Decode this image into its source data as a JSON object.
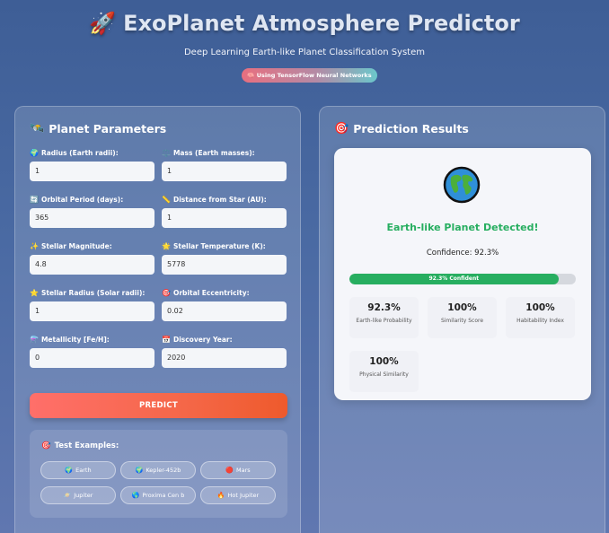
{
  "header": {
    "title": "ExoPlanet Atmosphere Predictor",
    "subtitle": "Deep Learning Earth-like Planet Classification System",
    "badge": "🧠 Using TensorFlow Neural Networks"
  },
  "left_panel": {
    "title": "Planet Parameters",
    "fields": [
      {
        "icon": "🌍",
        "label": "Radius (Earth radii):",
        "value": "1"
      },
      {
        "icon": "⚖️",
        "label": "Mass (Earth masses):",
        "value": "1"
      },
      {
        "icon": "🔄",
        "label": "Orbital Period (days):",
        "value": "365"
      },
      {
        "icon": "📏",
        "label": "Distance from Star (AU):",
        "value": "1"
      },
      {
        "icon": "✨",
        "label": "Stellar Magnitude:",
        "value": "4.8"
      },
      {
        "icon": "🌟",
        "label": "Stellar Temperature (K):",
        "value": "5778"
      },
      {
        "icon": "⭐",
        "label": "Stellar Radius (Solar radii):",
        "value": "1"
      },
      {
        "icon": "🎯",
        "label": "Orbital Eccentricity:",
        "value": "0.02"
      },
      {
        "icon": "⚗️",
        "label": "Metallicity [Fe/H]:",
        "value": "0"
      },
      {
        "icon": "📅",
        "label": "Discovery Year:",
        "value": "2020"
      }
    ],
    "predict_label": "PREDICT",
    "examples_title": "Test Examples:",
    "examples": [
      {
        "icon": "🌍",
        "label": "Earth"
      },
      {
        "icon": "🌍",
        "label": "Kepler-452b"
      },
      {
        "icon": "🔴",
        "label": "Mars"
      },
      {
        "icon": "🪐",
        "label": "Jupiter"
      },
      {
        "icon": "🌎",
        "label": "Proxima Cen b"
      },
      {
        "icon": "🔥",
        "label": "Hot Jupiter"
      }
    ]
  },
  "right_panel": {
    "title": "Prediction Results",
    "result_title": "Earth-like Planet Detected!",
    "confidence_text": "Confidence: 92.3%",
    "confidence_bar_label": "92.3% Confident",
    "confidence_value": 92.3,
    "metrics": [
      {
        "value": "92.3%",
        "label": "Earth-like Probability"
      },
      {
        "value": "100%",
        "label": "Similarity Score"
      },
      {
        "value": "100%",
        "label": "Habitability Index"
      },
      {
        "value": "100%",
        "label": "Physical Similarity"
      }
    ]
  },
  "colors": {
    "success": "#27ae60",
    "predict_button": "#f56748"
  }
}
